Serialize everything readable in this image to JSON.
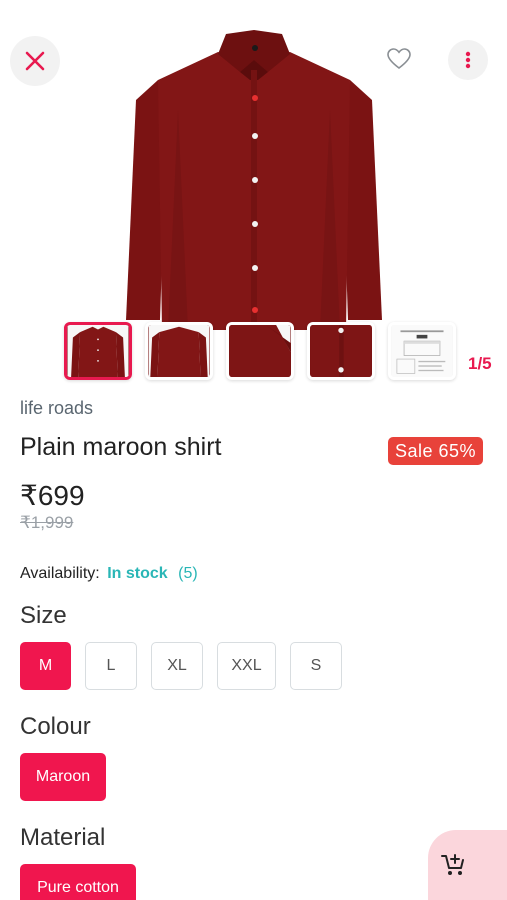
{
  "product": {
    "brand": "life roads",
    "name": "Plain maroon shirt",
    "sale_badge": "Sale 65%",
    "price": "₹699",
    "old_price": "₹1,999",
    "colors": {
      "accent": "#e8194f",
      "shirt": "#7a1212",
      "stock": "#29b6b6",
      "sale": "#e8423a"
    }
  },
  "gallery": {
    "counter": "1/5",
    "thumbnails": [
      "shirt-front",
      "shirt-back",
      "shirt-collar",
      "shirt-buttons",
      "size-chart"
    ]
  },
  "availability": {
    "label": "Availability:",
    "status": "In stock",
    "count": "(5)"
  },
  "size": {
    "label": "Size",
    "options": [
      "M",
      "L",
      "XL",
      "XXL",
      "S"
    ],
    "selected": "M"
  },
  "colour": {
    "label": "Colour",
    "options": [
      "Maroon"
    ],
    "selected": "Maroon"
  },
  "material": {
    "label": "Material",
    "options": [
      "Pure cotton"
    ],
    "selected": "Pure cotton"
  },
  "icons": {
    "close": "close-icon",
    "favorite": "heart-icon",
    "more": "more-vertical-icon",
    "cart": "add-to-cart-icon"
  }
}
